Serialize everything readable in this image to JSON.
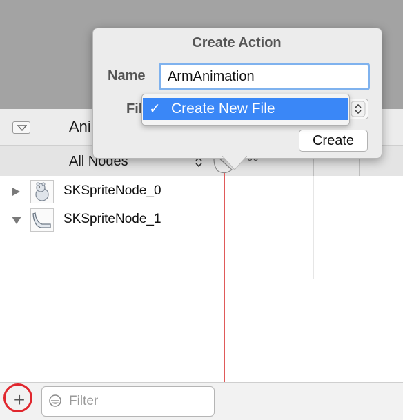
{
  "animation_panel": {
    "title": "Ani",
    "nodes_filter": "All Nodes",
    "ruler_label": "00"
  },
  "rows": [
    {
      "label": "SKSpriteNode_0",
      "expanded": false
    },
    {
      "label": "SKSpriteNode_1",
      "expanded": true
    }
  ],
  "bottom_bar": {
    "add_label": "+",
    "filter_placeholder": "Filter"
  },
  "popover": {
    "title": "Create Action",
    "name_label": "Name",
    "name_value": "ArmAnimation",
    "file_label": "Fil",
    "create_label": "Create"
  },
  "file_menu": {
    "check": "✓",
    "selected_item": "Create New File"
  },
  "colors": {
    "accent": "#3a87f7",
    "playhead": "#e05a5a",
    "highlight_ring": "#e0262d"
  }
}
